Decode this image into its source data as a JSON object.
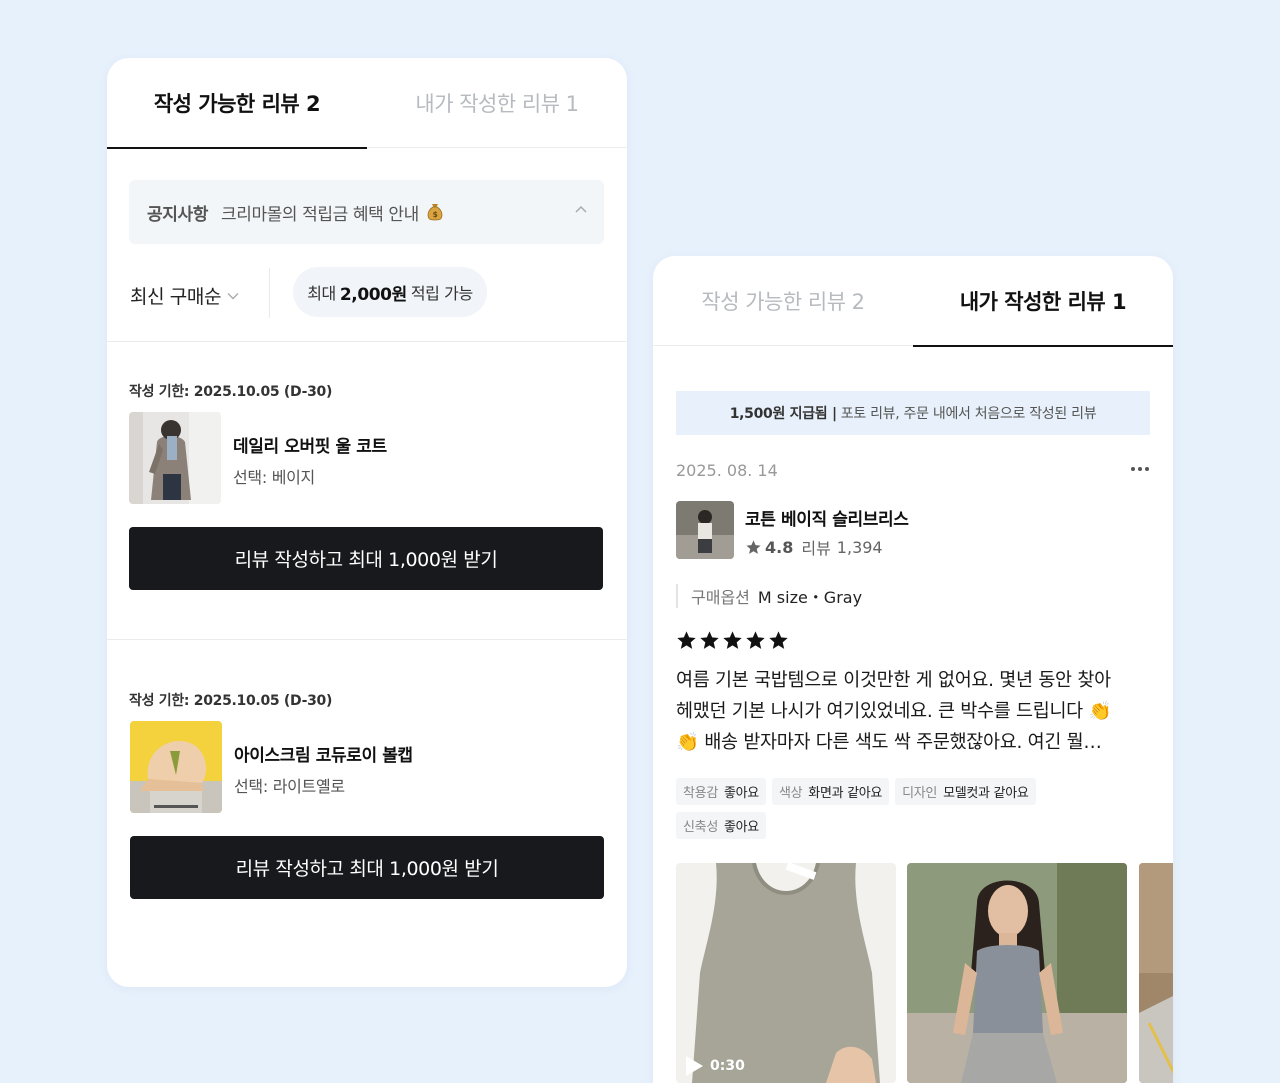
{
  "left_card": {
    "tabs": [
      {
        "label": "작성 가능한 리뷰 2",
        "active": true
      },
      {
        "label": "내가 작성한 리뷰 1",
        "active": false
      }
    ],
    "notice": {
      "label": "공지사항",
      "text": "크리마몰의 적립금 혜택 안내",
      "icon": "money-bag-icon"
    },
    "sort": {
      "label": "최신 구매순"
    },
    "reward_pill": {
      "prefix": "최대",
      "amount": "2,000원",
      "suffix": "적립 가능"
    },
    "items": [
      {
        "deadline": "작성 기한: 2025.10.05 (D-30)",
        "name": "데일리 오버핏 울 코트",
        "option": "선택: 베이지",
        "cta": "리뷰 작성하고 최대 1,000원 받기"
      },
      {
        "deadline": "작성 기한: 2025.10.05 (D-30)",
        "name": "아이스크림 코듀로이 볼캡",
        "option": "선택: 라이트옐로",
        "cta": "리뷰 작성하고 최대 1,000원 받기"
      }
    ]
  },
  "right_card": {
    "tabs": [
      {
        "label": "작성 가능한 리뷰 2",
        "active": false
      },
      {
        "label": "내가 작성한 리뷰 1",
        "active": true
      }
    ],
    "reward_banner": {
      "bold": "1,500원 지급됨 |",
      "text": "포토 리뷰, 주문 내에서 처음으로 작성된 리뷰"
    },
    "review": {
      "date": "2025. 08. 14",
      "product": {
        "name": "코튼 베이직 슬리브리스",
        "rating": "4.8",
        "review_label": "리뷰",
        "review_count": "1,394"
      },
      "option": {
        "label": "구매옵션",
        "value": "M size・Gray"
      },
      "stars": 5,
      "body_lines": [
        "여름 기본 국밥템으로 이것만한 게 없어요. 몇년 동안 찾아",
        "헤맸던 기본 나시가 여기있었네요. 큰 박수를 드립니다 👏",
        "👏  배송 받자마자 다른 색도 싹 주문했잖아요. 여긴 뭘…"
      ],
      "tags": [
        {
          "key": "착용감",
          "value": "좋아요"
        },
        {
          "key": "색상",
          "value": "화면과 같아요"
        },
        {
          "key": "디자인",
          "value": "모델컷과 같아요"
        },
        {
          "key": "신축성",
          "value": "좋아요"
        }
      ],
      "video_duration": "0:30"
    }
  },
  "colors": {
    "background": "#e7f1fc",
    "cta": "#17191d",
    "reward_banner": "#e8f1fb",
    "pill": "#f1f4f8"
  }
}
